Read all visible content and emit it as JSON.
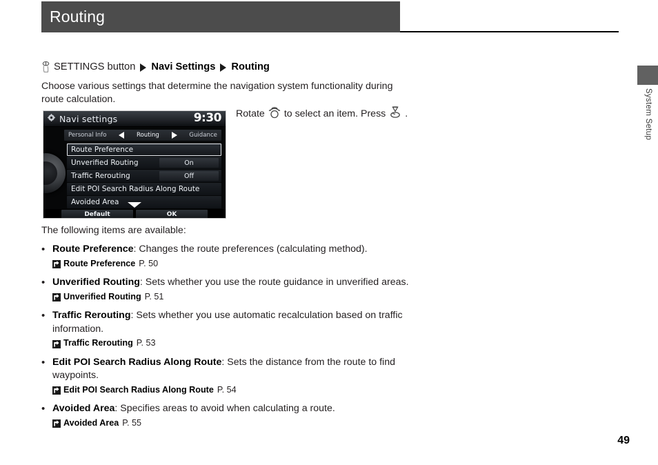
{
  "page": {
    "title": "Routing",
    "number": "49",
    "side_tab_label": "System Setup"
  },
  "breadcrumb": {
    "button_icon": "settings-button-icon",
    "button_label": "SETTINGS button",
    "step1": "Navi Settings",
    "step2": "Routing"
  },
  "intro": "Choose various settings that determine the navigation system functionality during route calculation.",
  "nav_screenshot": {
    "gear_icon": "gear-icon",
    "title": "Navi settings",
    "clock": "9:30",
    "tabs": {
      "left": "Personal Info",
      "center": "Routing",
      "right": "Guidance"
    },
    "rows": [
      {
        "label": "Route Preference",
        "value": "",
        "selected": true
      },
      {
        "label": "Unverified Routing",
        "value": "On",
        "selected": false
      },
      {
        "label": "Traffic Rerouting",
        "value": "Off",
        "selected": false
      },
      {
        "label": "Edit POI Search Radius Along Route",
        "value": "",
        "selected": false
      },
      {
        "label": "Avoided Area",
        "value": "",
        "selected": false
      }
    ],
    "footer": {
      "default_label": "Default",
      "ok_label": "OK"
    }
  },
  "rotate_caption": {
    "part1": "Rotate",
    "rotate_icon": "rotary-knob-rotate-icon",
    "part2": "to select an item. Press",
    "press_icon": "rotary-knob-press-icon",
    "part3": "."
  },
  "list": {
    "lead": "The following items are available:",
    "items": [
      {
        "term": "Route Preference",
        "description": ": Changes the route preferences (calculating method).",
        "ref_title": "Route Preference",
        "ref_page": "P. 50"
      },
      {
        "term": "Unverified Routing",
        "description": ": Sets whether you use the route guidance in unverified areas.",
        "ref_title": "Unverified Routing",
        "ref_page": "P. 51"
      },
      {
        "term": "Traffic Rerouting",
        "description": ": Sets whether you use automatic recalculation based on traffic information.",
        "ref_title": "Traffic Rerouting",
        "ref_page": "P. 53"
      },
      {
        "term": "Edit POI Search Radius Along Route",
        "description": ": Sets the distance from the route to find waypoints.",
        "ref_title": "Edit POI Search Radius Along Route",
        "ref_page": "P. 54"
      },
      {
        "term": "Avoided Area",
        "description": ": Specifies areas to avoid when calculating a route.",
        "ref_title": "Avoided Area",
        "ref_page": "P. 55"
      }
    ],
    "bullet_glyph": "•"
  },
  "colors": {
    "header_bg": "#4c4c4c",
    "side_tab_bg": "#616161",
    "text": "#231f20"
  }
}
